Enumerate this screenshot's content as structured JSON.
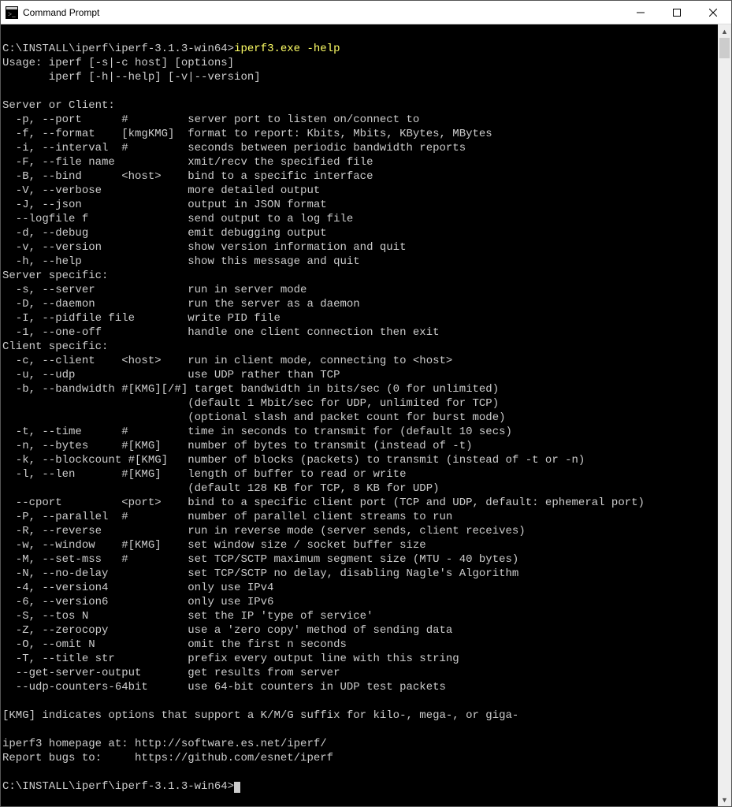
{
  "window": {
    "title": "Command Prompt"
  },
  "term": {
    "prompt1": "C:\\INSTALL\\iperf\\iperf-3.1.3-win64>",
    "command": "iperf3.exe -help",
    "usage1": "Usage: iperf [-s|-c host] [options]",
    "usage2": "       iperf [-h|--help] [-v|--version]",
    "hdr_server_or_client": "Server or Client:",
    "opt_p": "  -p, --port      #         server port to listen on/connect to",
    "opt_f": "  -f, --format    [kmgKMG]  format to report: Kbits, Mbits, KBytes, MBytes",
    "opt_i": "  -i, --interval  #         seconds between periodic bandwidth reports",
    "opt_F": "  -F, --file name           xmit/recv the specified file",
    "opt_B": "  -B, --bind      <host>    bind to a specific interface",
    "opt_V": "  -V, --verbose             more detailed output",
    "opt_J": "  -J, --json                output in JSON format",
    "opt_logfile": "  --logfile f               send output to a log file",
    "opt_d": "  -d, --debug               emit debugging output",
    "opt_v": "  -v, --version             show version information and quit",
    "opt_h": "  -h, --help                show this message and quit",
    "hdr_server": "Server specific:",
    "opt_s": "  -s, --server              run in server mode",
    "opt_D": "  -D, --daemon              run the server as a daemon",
    "opt_I": "  -I, --pidfile file        write PID file",
    "opt_1": "  -1, --one-off             handle one client connection then exit",
    "hdr_client": "Client specific:",
    "opt_c": "  -c, --client    <host>    run in client mode, connecting to <host>",
    "opt_u": "  -u, --udp                 use UDP rather than TCP",
    "opt_b": "  -b, --bandwidth #[KMG][/#] target bandwidth in bits/sec (0 for unlimited)",
    "opt_b2": "                            (default 1 Mbit/sec for UDP, unlimited for TCP)",
    "opt_b3": "                            (optional slash and packet count for burst mode)",
    "opt_t": "  -t, --time      #         time in seconds to transmit for (default 10 secs)",
    "opt_n": "  -n, --bytes     #[KMG]    number of bytes to transmit (instead of -t)",
    "opt_k": "  -k, --blockcount #[KMG]   number of blocks (packets) to transmit (instead of -t or -n)",
    "opt_l": "  -l, --len       #[KMG]    length of buffer to read or write",
    "opt_l2": "                            (default 128 KB for TCP, 8 KB for UDP)",
    "opt_cport": "  --cport         <port>    bind to a specific client port (TCP and UDP, default: ephemeral port)",
    "opt_P": "  -P, --parallel  #         number of parallel client streams to run",
    "opt_R": "  -R, --reverse             run in reverse mode (server sends, client receives)",
    "opt_w": "  -w, --window    #[KMG]    set window size / socket buffer size",
    "opt_M": "  -M, --set-mss   #         set TCP/SCTP maximum segment size (MTU - 40 bytes)",
    "opt_N": "  -N, --no-delay            set TCP/SCTP no delay, disabling Nagle's Algorithm",
    "opt_4": "  -4, --version4            only use IPv4",
    "opt_6": "  -6, --version6            only use IPv6",
    "opt_S": "  -S, --tos N               set the IP 'type of service'",
    "opt_Z": "  -Z, --zerocopy            use a 'zero copy' method of sending data",
    "opt_O": "  -O, --omit N              omit the first n seconds",
    "opt_T": "  -T, --title str           prefix every output line with this string",
    "opt_gso": "  --get-server-output       get results from server",
    "opt_udp64": "  --udp-counters-64bit      use 64-bit counters in UDP test packets",
    "kmg": "[KMG] indicates options that support a K/M/G suffix for kilo-, mega-, or giga-",
    "homepage": "iperf3 homepage at: http://software.es.net/iperf/",
    "bugs": "Report bugs to:     https://github.com/esnet/iperf",
    "prompt2": "C:\\INSTALL\\iperf\\iperf-3.1.3-win64>"
  }
}
